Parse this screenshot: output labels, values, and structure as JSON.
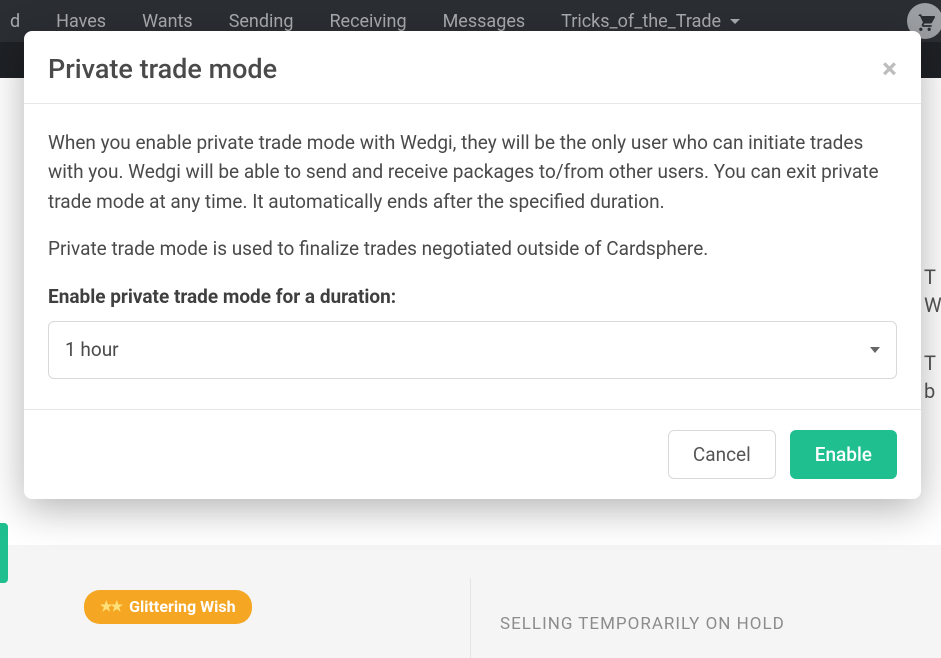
{
  "nav": {
    "items": [
      "d",
      "Haves",
      "Wants",
      "Sending",
      "Receiving",
      "Messages",
      "Tricks_of_the_Trade"
    ],
    "has_dropdown_index": 6,
    "cart_icon": "cart-icon"
  },
  "bg": {
    "right_lines": [
      "T",
      "W",
      "T",
      "b"
    ],
    "badge_text": "Glittering Wish",
    "panel_text": "SELLING TEMPORARILY ON HOLD"
  },
  "modal": {
    "title": "Private trade mode",
    "paragraph1": "When you enable private trade mode with Wedgi, they will be the only user who can initiate trades with you. Wedgi will be able to send and receive packages to/from other users. You can exit private trade mode at any time. It automatically ends after the specified duration.",
    "paragraph2": "Private trade mode is used to finalize trades negotiated outside of Cardsphere.",
    "duration_label": "Enable private trade mode for a duration:",
    "select_value": "1 hour",
    "cancel_label": "Cancel",
    "enable_label": "Enable"
  }
}
